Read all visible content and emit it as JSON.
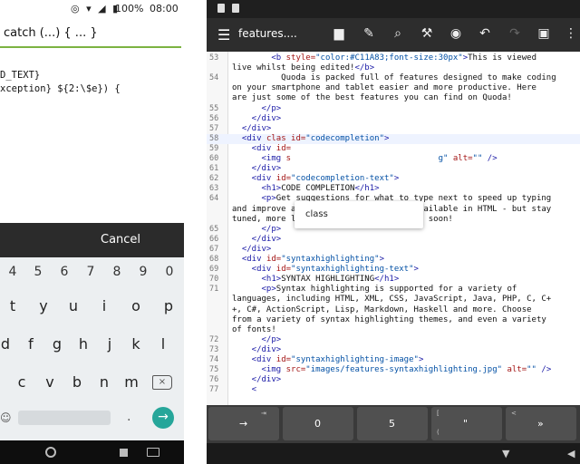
{
  "left": {
    "status": {
      "battery": "100%",
      "time": "08:00"
    },
    "snippet_input": "catch (...) { ... }",
    "code_lines": [
      "D_TEXT}",
      "xception} ${2:\\$e}) {"
    ],
    "cancel_label": "Cancel",
    "keyboard": {
      "row_numbers": [
        "4",
        "5",
        "6",
        "7",
        "8",
        "9",
        "0"
      ],
      "row1": [
        "t",
        "y",
        "u",
        "i",
        "o",
        "p"
      ],
      "row2": [
        "d",
        "f",
        "g",
        "h",
        "j",
        "k",
        "l"
      ],
      "row3": [
        "c",
        "v",
        "b",
        "n",
        "m"
      ],
      "dot": ".",
      "enter": "→"
    }
  },
  "right": {
    "file_title": "features....",
    "autocomplete": {
      "item": "class"
    },
    "lines": [
      {
        "n": "53",
        "parts": [
          [
            "t",
            "        "
          ],
          [
            "tag",
            "<b "
          ],
          [
            "attr",
            "style="
          ],
          [
            "str",
            "\"color:#C11A83;font-size:30px\""
          ],
          [
            "tag",
            ">"
          ],
          [
            "txtc",
            "This is viewed"
          ]
        ]
      },
      {
        "n": "",
        "parts": [
          [
            "txtc",
            "live whilst being edited!"
          ],
          [
            "tag",
            "</b>"
          ]
        ]
      },
      {
        "n": "54",
        "parts": [
          [
            "txtc",
            "          Quoda is packed full of features designed to make coding"
          ]
        ]
      },
      {
        "n": "",
        "parts": [
          [
            "txtc",
            "on your smartphone and tablet easier and more productive. Here"
          ]
        ]
      },
      {
        "n": "",
        "parts": [
          [
            "txtc",
            "are just some of the best features you can find on Quoda!"
          ]
        ]
      },
      {
        "n": "55",
        "parts": [
          [
            "tag",
            "      </p>"
          ]
        ]
      },
      {
        "n": "56",
        "parts": [
          [
            "tag",
            "    </div>"
          ]
        ]
      },
      {
        "n": "57",
        "parts": [
          [
            "tag",
            "  </div>"
          ]
        ]
      },
      {
        "n": "58",
        "parts": [
          [
            "tag",
            "  <div "
          ],
          [
            "attr",
            "clas id="
          ],
          [
            "str",
            "\"codecompletion\""
          ],
          [
            "tag",
            ">"
          ]
        ],
        "hl": true
      },
      {
        "n": "59",
        "parts": [
          [
            "tag",
            "    <div "
          ],
          [
            "attr",
            "id="
          ]
        ]
      },
      {
        "n": "60",
        "parts": [
          [
            "tag",
            "      <img "
          ],
          [
            "attr",
            "s"
          ],
          [
            "t",
            "                              "
          ],
          [
            "str",
            "g\""
          ],
          [
            "attr",
            " alt="
          ],
          [
            "str",
            "\"\""
          ],
          [
            "tag",
            " />"
          ]
        ]
      },
      {
        "n": "61",
        "parts": [
          [
            "tag",
            "    </div>"
          ]
        ]
      },
      {
        "n": "62",
        "parts": [
          [
            "tag",
            "    <div "
          ],
          [
            "attr",
            "id="
          ],
          [
            "str",
            "\"codecompletion-text\""
          ],
          [
            "tag",
            ">"
          ]
        ]
      },
      {
        "n": "63",
        "parts": [
          [
            "tag",
            "      <h1>"
          ],
          [
            "txtc",
            "CODE COMPLETION"
          ],
          [
            "tag",
            "</h1>"
          ]
        ]
      },
      {
        "n": "64",
        "parts": [
          [
            "tag",
            "      <p>"
          ],
          [
            "txtc",
            "Get suggestions for what to type next to speed up typing"
          ]
        ]
      },
      {
        "n": "",
        "parts": [
          [
            "txtc",
            "and improve accuracy. Currently only available in HTML - but stay"
          ]
        ]
      },
      {
        "n": "",
        "parts": [
          [
            "txtc",
            "tuned, more languages will be supported soon!"
          ]
        ]
      },
      {
        "n": "65",
        "parts": [
          [
            "tag",
            "      </p>"
          ]
        ]
      },
      {
        "n": "66",
        "parts": [
          [
            "tag",
            "    </div>"
          ]
        ]
      },
      {
        "n": "67",
        "parts": [
          [
            "tag",
            "  </div>"
          ]
        ]
      },
      {
        "n": "68",
        "parts": [
          [
            "tag",
            "  <div "
          ],
          [
            "attr",
            "id="
          ],
          [
            "str",
            "\"syntaxhighlighting\""
          ],
          [
            "tag",
            ">"
          ]
        ]
      },
      {
        "n": "69",
        "parts": [
          [
            "tag",
            "    <div "
          ],
          [
            "attr",
            "id="
          ],
          [
            "str",
            "\"syntaxhighlighting-text\""
          ],
          [
            "tag",
            ">"
          ]
        ]
      },
      {
        "n": "70",
        "parts": [
          [
            "tag",
            "      <h1>"
          ],
          [
            "txtc",
            "SYNTAX HIGHLIGHTING"
          ],
          [
            "tag",
            "</h1>"
          ]
        ]
      },
      {
        "n": "71",
        "parts": [
          [
            "tag",
            "      <p>"
          ],
          [
            "txtc",
            "Syntax highlighting is supported for a variety of"
          ]
        ]
      },
      {
        "n": "",
        "parts": [
          [
            "txtc",
            "languages, including HTML, XML, CSS, JavaScript, Java, PHP, C, C+"
          ]
        ]
      },
      {
        "n": "",
        "parts": [
          [
            "txtc",
            "+, C#, ActionScript, Lisp, Markdown, Haskell and more. Choose"
          ]
        ]
      },
      {
        "n": "",
        "parts": [
          [
            "txtc",
            "from a variety of syntax highlighting themes, and even a variety"
          ]
        ]
      },
      {
        "n": "",
        "parts": [
          [
            "txtc",
            "of fonts!"
          ]
        ]
      },
      {
        "n": "72",
        "parts": [
          [
            "tag",
            "      </p>"
          ]
        ]
      },
      {
        "n": "73",
        "parts": [
          [
            "tag",
            "    </div>"
          ]
        ]
      },
      {
        "n": "74",
        "parts": [
          [
            "tag",
            "    <div "
          ],
          [
            "attr",
            "id="
          ],
          [
            "str",
            "\"syntaxhighlighting-image\""
          ],
          [
            "tag",
            ">"
          ]
        ]
      },
      {
        "n": "75",
        "parts": [
          [
            "tag",
            "      <img "
          ],
          [
            "attr",
            "src="
          ],
          [
            "str",
            "\"images/features-syntaxhighlighting.jpg\""
          ],
          [
            "attr",
            " alt="
          ],
          [
            "str",
            "\"\""
          ],
          [
            "tag",
            " />"
          ]
        ]
      },
      {
        "n": "76",
        "parts": [
          [
            "tag",
            "    </div>"
          ]
        ]
      },
      {
        "n": "77",
        "parts": [
          [
            "tag",
            "    <"
          ]
        ]
      }
    ],
    "extra_keys": [
      {
        "tl": "⇥",
        "bl": "→",
        "big": ""
      },
      {
        "tl": "",
        "bl": "",
        "big": "0"
      },
      {
        "tl": "",
        "bl": "",
        "big": "5"
      },
      {
        "tl": "[",
        "bl": "(",
        "big": "\""
      },
      {
        "tl": "<",
        "bl": "",
        "big": "»"
      }
    ]
  }
}
